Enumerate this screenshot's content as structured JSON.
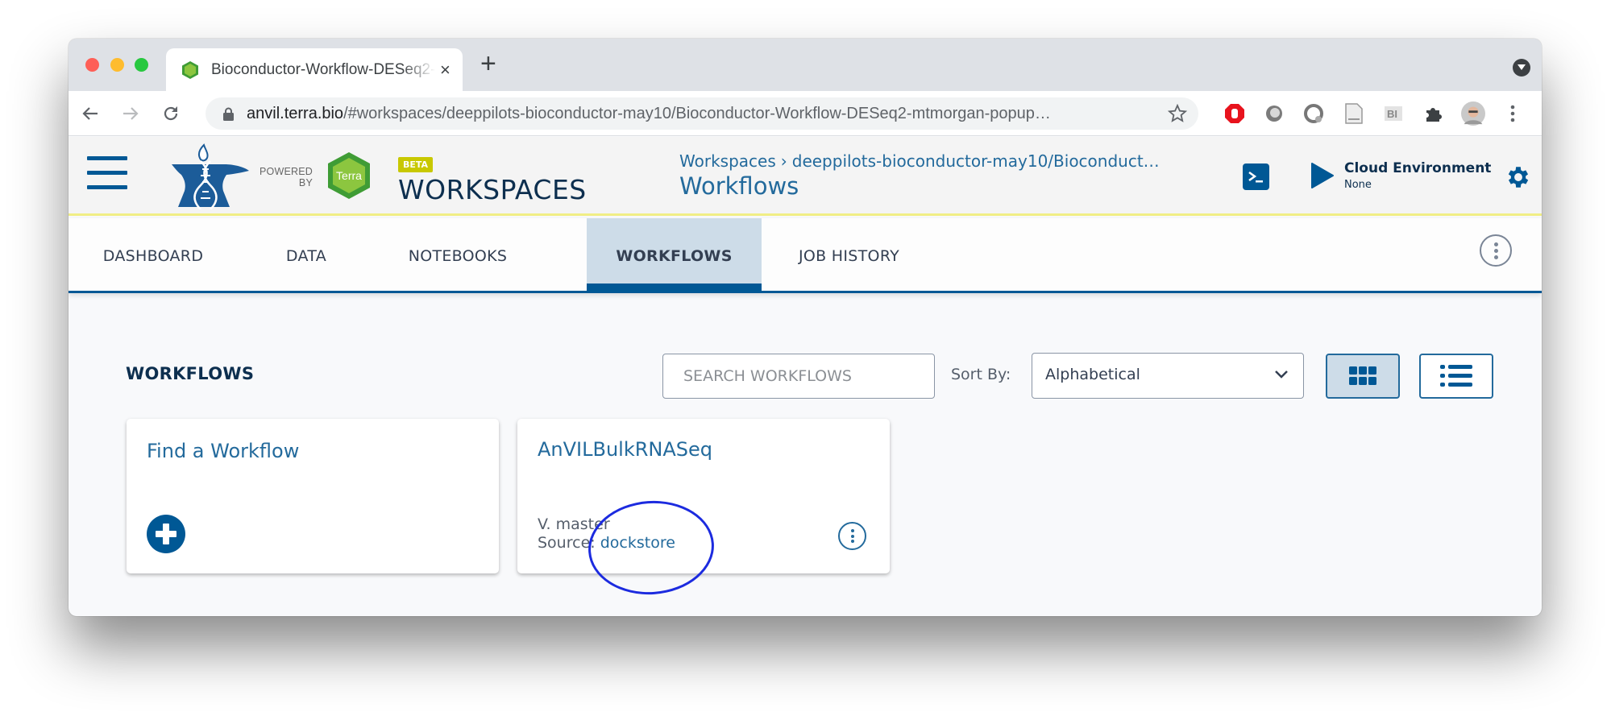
{
  "browser": {
    "tab": {
      "title": "Bioconductor-Workflow-DESeq2-mtmorgan-popup",
      "favicon": "terra-hex-icon",
      "close_glyph": "×"
    },
    "new_tab_glyph": "+",
    "url_host": "anvil.terra.bio",
    "url_path": "/#workspaces/deeppilots-bioconductor-may10/Bioconductor-Workflow-DESeq2-mtmorgan-popup…",
    "extensions": [
      "adblock-icon",
      "circle-extension-icon",
      "refresh-extension-icon",
      "document-extension-icon",
      "bi-extension-icon",
      "puzzle-icon",
      "profile-avatar",
      "kebab-menu-icon"
    ]
  },
  "header": {
    "powered_line1": "POWERED",
    "powered_line2": "BY",
    "terra_label": "Terra",
    "beta_badge": "BETA",
    "brand_title": "WORKSPACES",
    "breadcrumb": {
      "root": "Workspaces",
      "separator": "›",
      "workspace": "deeppilots-bioconductor-may10/Bioconduct…"
    },
    "page_title": "Workflows",
    "cloud_env": {
      "title": "Cloud Environment",
      "status": "None"
    }
  },
  "tabs": [
    {
      "label": "DASHBOARD",
      "active": false
    },
    {
      "label": "DATA",
      "active": false
    },
    {
      "label": "NOTEBOOKS",
      "active": false
    },
    {
      "label": "WORKFLOWS",
      "active": true
    },
    {
      "label": "JOB HISTORY",
      "active": false
    }
  ],
  "workflows": {
    "section_title": "WORKFLOWS",
    "search_placeholder": "SEARCH WORKFLOWS",
    "search_value": "",
    "sort_label": "Sort By:",
    "sort_value": "Alphabetical",
    "view_mode": "grid",
    "find_card": {
      "title": "Find a Workflow"
    },
    "cards": [
      {
        "name": "AnVILBulkRNASeq",
        "version": "V. master",
        "source_label": "Source:",
        "source": "dockstore"
      }
    ]
  },
  "colors": {
    "brand_blue": "#005895",
    "link_blue": "#236a9c",
    "header_bg": "#f4f4f4",
    "active_tab_bg": "#cddce8",
    "beta_badge": "#c8c800",
    "annotation": "#1c2bdf"
  }
}
